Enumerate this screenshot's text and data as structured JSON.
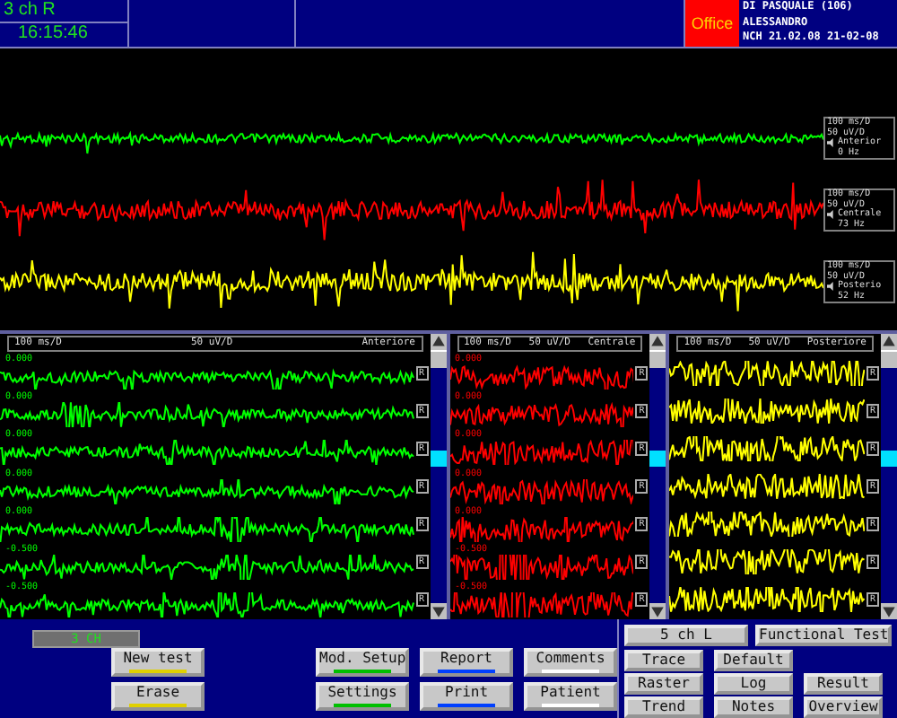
{
  "header": {
    "channel_mode": "3 ch R",
    "time": "16:15:46",
    "office_badge": "Office",
    "patient_name": "DI PASQUALE (106)",
    "patient_first_name": "ALESSANDRO",
    "exam_info": "NCH 21.02.08  21-02-08"
  },
  "overview_traces": [
    {
      "color": "#00ff00",
      "scale_time": "100 ms/D",
      "scale_amp": "50 uV/D",
      "site": "Anterior",
      "rate": "0 Hz"
    },
    {
      "color": "#ff0000",
      "scale_time": "100 ms/D",
      "scale_amp": "50 uV/D",
      "site": "Centrale",
      "rate": "73 Hz"
    },
    {
      "color": "#ffff00",
      "scale_time": "100 ms/D",
      "scale_amp": "50 uV/D",
      "site": "Posterio",
      "rate": "52 Hz"
    }
  ],
  "raster_panels": [
    {
      "color": "#00ff00",
      "scale_time": "100 ms/D",
      "scale_amp": "50 uV/D",
      "site": "Anteriore",
      "rows": [
        {
          "value": "0.000",
          "button": "R"
        },
        {
          "value": "0.000",
          "button": "R"
        },
        {
          "value": "0.000",
          "button": "R"
        },
        {
          "value": "0.000",
          "button": "R"
        },
        {
          "value": "0.000",
          "button": "R"
        },
        {
          "value": "-0.500",
          "button": "R"
        },
        {
          "value": "-0.500",
          "button": "R"
        }
      ]
    },
    {
      "color": "#ff0000",
      "scale_time": "100 ms/D",
      "scale_amp": "50 uV/D",
      "site": "Centrale",
      "rows": [
        {
          "value": "0.000",
          "button": "R"
        },
        {
          "value": "0.000",
          "button": "R"
        },
        {
          "value": "0.000",
          "button": "R"
        },
        {
          "value": "0.000",
          "button": "R"
        },
        {
          "value": "0.000",
          "button": "R"
        },
        {
          "value": "-0.500",
          "button": "R"
        },
        {
          "value": "-0.500",
          "button": "R"
        }
      ]
    },
    {
      "color": "#ffff00",
      "scale_time": "100 ms/D",
      "scale_amp": "50 uV/D",
      "site": "Posteriore",
      "rows": [
        {
          "button": "R"
        },
        {
          "button": "R"
        },
        {
          "button": "R"
        },
        {
          "button": "R"
        },
        {
          "button": "R"
        },
        {
          "button": "R"
        },
        {
          "button": "R"
        }
      ]
    }
  ],
  "channel_indicator": "3 CH",
  "button_columns": [
    {
      "color": "#e0d000",
      "buttons": [
        "New test",
        "Erase"
      ]
    },
    {
      "color": "#00c000",
      "buttons": [
        "Mod. Setup",
        "Settings"
      ]
    },
    {
      "color": "#0040ff",
      "buttons": [
        "Report",
        "Print"
      ]
    },
    {
      "color": "#ffffff",
      "buttons": [
        "Comments",
        "Patient"
      ]
    }
  ],
  "side_mode_button": "5 ch L",
  "functional_test_button": "Functional Test",
  "view_buttons": [
    [
      "Trace",
      "Default"
    ],
    [
      "Raster",
      "Log",
      "Result"
    ],
    [
      "Trend",
      "Notes",
      "Overview"
    ]
  ]
}
